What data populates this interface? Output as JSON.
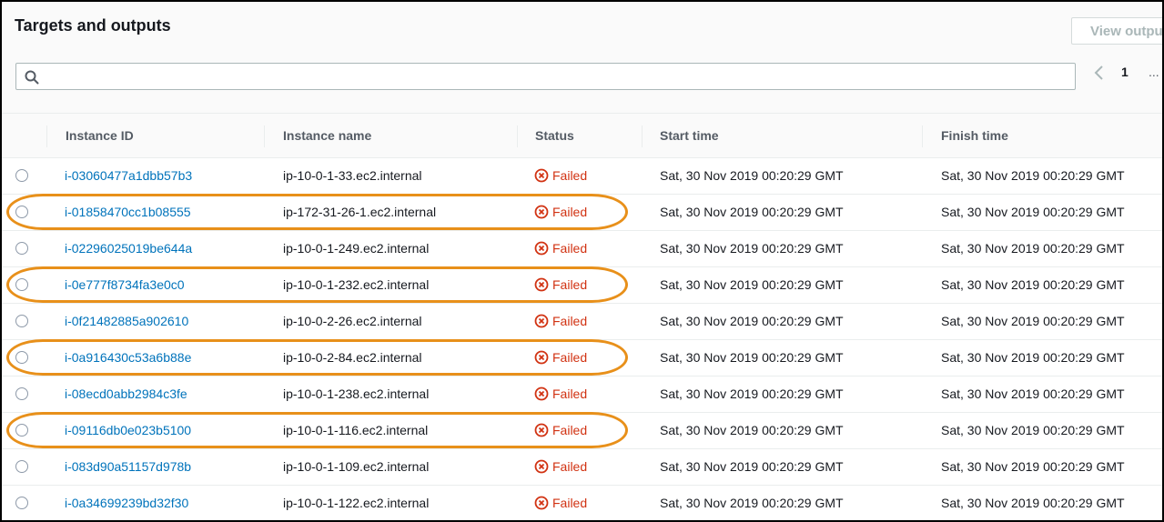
{
  "panel": {
    "title": "Targets and outputs",
    "view_output_label": "View output"
  },
  "search": {
    "placeholder": "",
    "value": ""
  },
  "pagination": {
    "current_page": "1",
    "ellipsis": "..."
  },
  "table": {
    "columns": [
      "Instance ID",
      "Instance name",
      "Status",
      "Start time",
      "Finish time"
    ],
    "rows": [
      {
        "instance_id": "i-03060477a1dbb57b3",
        "instance_name": "ip-10-0-1-33.ec2.internal",
        "status": "Failed",
        "start_time": "Sat, 30 Nov 2019 00:20:29 GMT",
        "finish_time": "Sat, 30 Nov 2019 00:20:29 GMT",
        "highlighted": false
      },
      {
        "instance_id": "i-01858470cc1b08555",
        "instance_name": "ip-172-31-26-1.ec2.internal",
        "status": "Failed",
        "start_time": "Sat, 30 Nov 2019 00:20:29 GMT",
        "finish_time": "Sat, 30 Nov 2019 00:20:29 GMT",
        "highlighted": true
      },
      {
        "instance_id": "i-02296025019be644a",
        "instance_name": "ip-10-0-1-249.ec2.internal",
        "status": "Failed",
        "start_time": "Sat, 30 Nov 2019 00:20:29 GMT",
        "finish_time": "Sat, 30 Nov 2019 00:20:29 GMT",
        "highlighted": false
      },
      {
        "instance_id": "i-0e777f8734fa3e0c0",
        "instance_name": "ip-10-0-1-232.ec2.internal",
        "status": "Failed",
        "start_time": "Sat, 30 Nov 2019 00:20:29 GMT",
        "finish_time": "Sat, 30 Nov 2019 00:20:29 GMT",
        "highlighted": true
      },
      {
        "instance_id": "i-0f21482885a902610",
        "instance_name": "ip-10-0-2-26.ec2.internal",
        "status": "Failed",
        "start_time": "Sat, 30 Nov 2019 00:20:29 GMT",
        "finish_time": "Sat, 30 Nov 2019 00:20:29 GMT",
        "highlighted": false
      },
      {
        "instance_id": "i-0a916430c53a6b88e",
        "instance_name": "ip-10-0-2-84.ec2.internal",
        "status": "Failed",
        "start_time": "Sat, 30 Nov 2019 00:20:29 GMT",
        "finish_time": "Sat, 30 Nov 2019 00:20:29 GMT",
        "highlighted": true
      },
      {
        "instance_id": "i-08ecd0abb2984c3fe",
        "instance_name": "ip-10-0-1-238.ec2.internal",
        "status": "Failed",
        "start_time": "Sat, 30 Nov 2019 00:20:29 GMT",
        "finish_time": "Sat, 30 Nov 2019 00:20:29 GMT",
        "highlighted": false
      },
      {
        "instance_id": "i-09116db0e023b5100",
        "instance_name": "ip-10-0-1-116.ec2.internal",
        "status": "Failed",
        "start_time": "Sat, 30 Nov 2019 00:20:29 GMT",
        "finish_time": "Sat, 30 Nov 2019 00:20:29 GMT",
        "highlighted": true
      },
      {
        "instance_id": "i-083d90a51157d978b",
        "instance_name": "ip-10-0-1-109.ec2.internal",
        "status": "Failed",
        "start_time": "Sat, 30 Nov 2019 00:20:29 GMT",
        "finish_time": "Sat, 30 Nov 2019 00:20:29 GMT",
        "highlighted": false
      },
      {
        "instance_id": "i-0a34699239bd32f30",
        "instance_name": "ip-10-0-1-122.ec2.internal",
        "status": "Failed",
        "start_time": "Sat, 30 Nov 2019 00:20:29 GMT",
        "finish_time": "Sat, 30 Nov 2019 00:20:29 GMT",
        "highlighted": false
      }
    ]
  },
  "icons": {
    "search": "search-icon",
    "pager_prev": "chevron-left-icon",
    "status_failed": "error-circle-icon",
    "row_select": "radio-button"
  },
  "colors": {
    "link": "#0073bb",
    "failed": "#d13212",
    "highlight": "#e8901a"
  }
}
